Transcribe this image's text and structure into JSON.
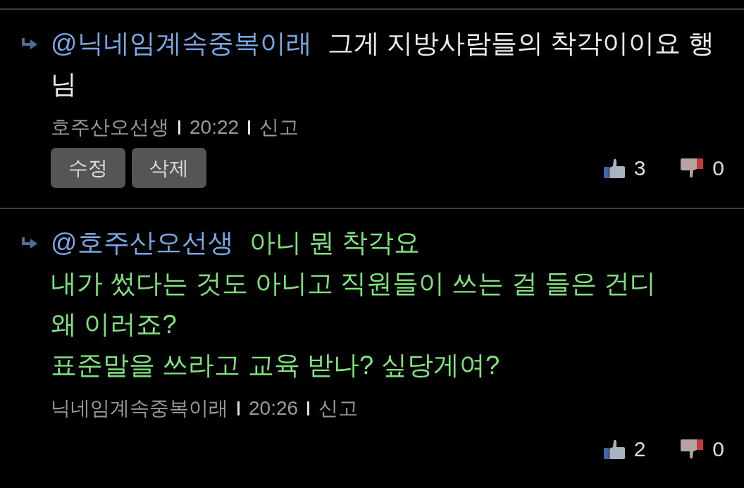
{
  "comments": [
    {
      "mention": "@닉네임계속중복이래",
      "body": "그게 지방사람들의 착각이이요 행님",
      "color": "#ececec",
      "author": "호주산오선생",
      "time": "20:22",
      "report": "신고",
      "buttons": [
        "수정",
        "삭제"
      ],
      "likes": "3",
      "dislikes": "0"
    },
    {
      "mention": "@호주산오선생",
      "body": "아니 뭔 착각요\n내가 썼다는 것도 아니고 직원들이 쓰는 걸 들은 건디\n왜 이러죠?\n표준말을 쓰라고 교육 받나? 싶당게여?",
      "color": "#80e27f",
      "author": "닉네임계속중복이래",
      "time": "20:26",
      "report": "신고",
      "likes": "2",
      "dislikes": "0"
    }
  ]
}
